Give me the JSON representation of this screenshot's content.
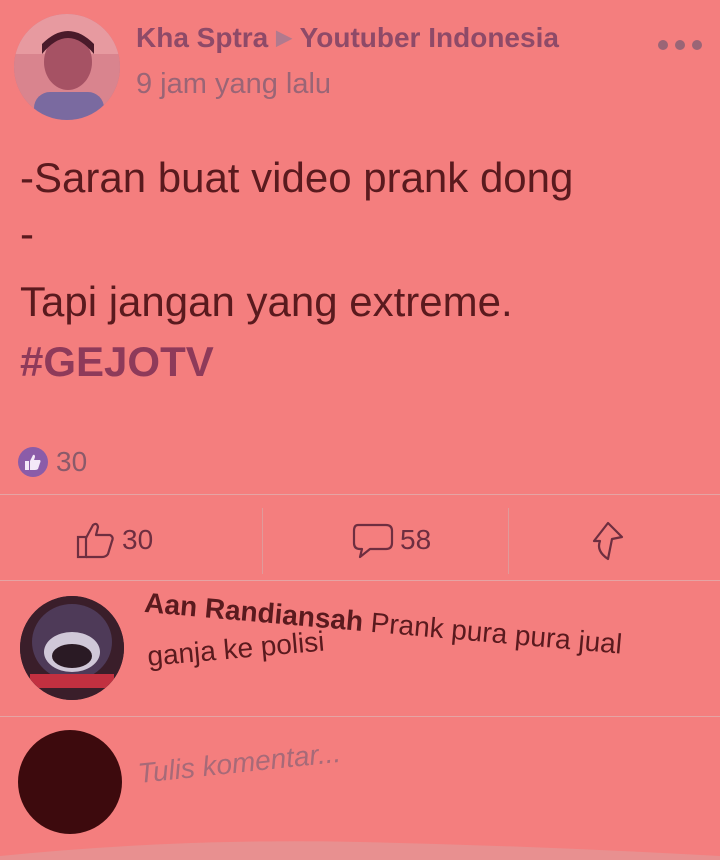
{
  "post": {
    "author": "Kha Sptra",
    "group": "Youtuber Indonesia",
    "timestamp": "9 jam yang lalu",
    "lines": [
      "-Saran buat video prank dong",
      "-",
      "Tapi jangan yang extreme."
    ],
    "hashtag": "#GEJOTV",
    "reaction_count": "30"
  },
  "actions": {
    "like_count": "30",
    "comment_count": "58"
  },
  "comment": {
    "author": "Aan Randiansah",
    "text_line1": "Prank pura pura jual",
    "text_line2": "ganja ke polisi"
  },
  "composer": {
    "placeholder": "Tulis komentar..."
  },
  "icons": {
    "more": "more-dots-icon",
    "like_badge": "thumbs-up-badge-icon",
    "like": "thumbs-up-icon",
    "comment": "comment-bubble-icon",
    "share": "share-arrow-icon"
  },
  "colors": {
    "background": "#f47e7e",
    "like_badge": "#8b5ca8",
    "text": "#5a1a1e"
  }
}
